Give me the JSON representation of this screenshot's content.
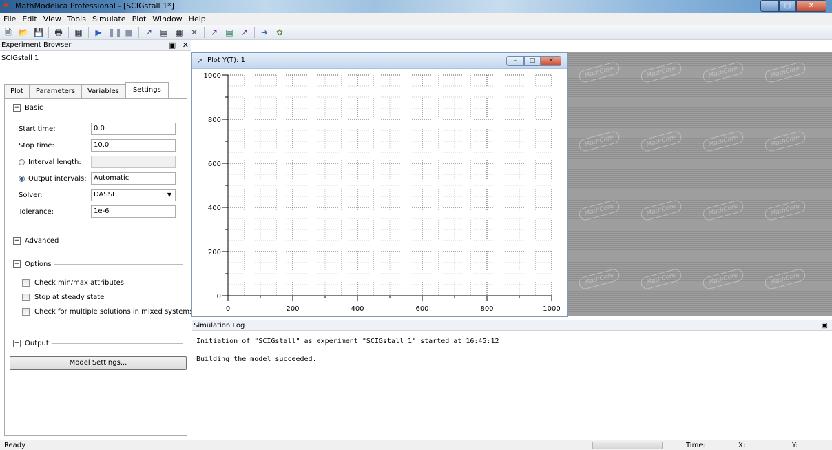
{
  "window": {
    "title": "MathModelica Professional  - [SCIGstall 1*]",
    "minimize_icon": "–",
    "maximize_icon": "□",
    "close_icon": "✕"
  },
  "menu": [
    "File",
    "Edit",
    "View",
    "Tools",
    "Simulate",
    "Plot",
    "Window",
    "Help"
  ],
  "toolbar": {
    "icons": [
      "new-file-icon",
      "open-folder-icon",
      "save-icon",
      "print-icon",
      "model-icon",
      "play-icon",
      "pause-icon",
      "stop-icon",
      "plot-icon",
      "plot-window-icon",
      "table-icon",
      "delete-icon",
      "line-plot-icon",
      "parametric-plot-icon",
      "bar-plot-icon",
      "export-icon",
      "settings-icon"
    ]
  },
  "experiment_browser": {
    "title": "Experiment Browser",
    "pin_icon": "▣",
    "close_icon": "✕",
    "model_name": "SCIGstall 1",
    "tabs": [
      "Plot",
      "Parameters",
      "Variables",
      "Settings"
    ],
    "active_tab": "Settings",
    "basic": {
      "label": "Basic",
      "toggle": "−",
      "start_time_label": "Start time:",
      "start_time_value": "0.0",
      "stop_time_label": "Stop time:",
      "stop_time_value": "10.0",
      "interval_length_label": "Interval length:",
      "interval_length_value": "",
      "output_intervals_label": "Output intervals:",
      "output_intervals_value": "Automatic",
      "solver_label": "Solver:",
      "solver_value": "DASSL",
      "tolerance_label": "Tolerance:",
      "tolerance_value": "1e-6"
    },
    "advanced": {
      "label": "Advanced",
      "toggle": "+"
    },
    "options": {
      "label": "Options",
      "toggle": "−",
      "check_minmax": "Check min/max attributes",
      "stop_steady": "Stop at steady state",
      "check_multiple": "Check for multiple solutions in mixed systems"
    },
    "output": {
      "label": "Output",
      "toggle": "+"
    },
    "model_settings_button": "Model Settings..."
  },
  "plot_window": {
    "title": "Plot Y(T): 1",
    "minimize_icon": "–",
    "maximize_icon": "□",
    "close_icon": "✕"
  },
  "chart_data": {
    "type": "line",
    "title": "",
    "xlabel": "",
    "ylabel": "",
    "xlim": [
      0,
      1000
    ],
    "ylim": [
      0,
      1000
    ],
    "x_ticks": [
      0,
      200,
      400,
      600,
      800,
      1000
    ],
    "y_ticks": [
      0,
      200,
      400,
      600,
      800,
      1000
    ],
    "grid": true,
    "series": []
  },
  "watermark_text": "MathCore",
  "simulation_log": {
    "title": "Simulation Log",
    "pin_icon": "▣",
    "lines": [
      "Initiation of \"SCIGstall\" as experiment \"SCIGstall 1\" started at 16:45:12",
      "Building the model succeeded."
    ]
  },
  "status_bar": {
    "text": "Ready",
    "time_label": "Time:",
    "x_label": "X:",
    "y_label": "Y:"
  }
}
